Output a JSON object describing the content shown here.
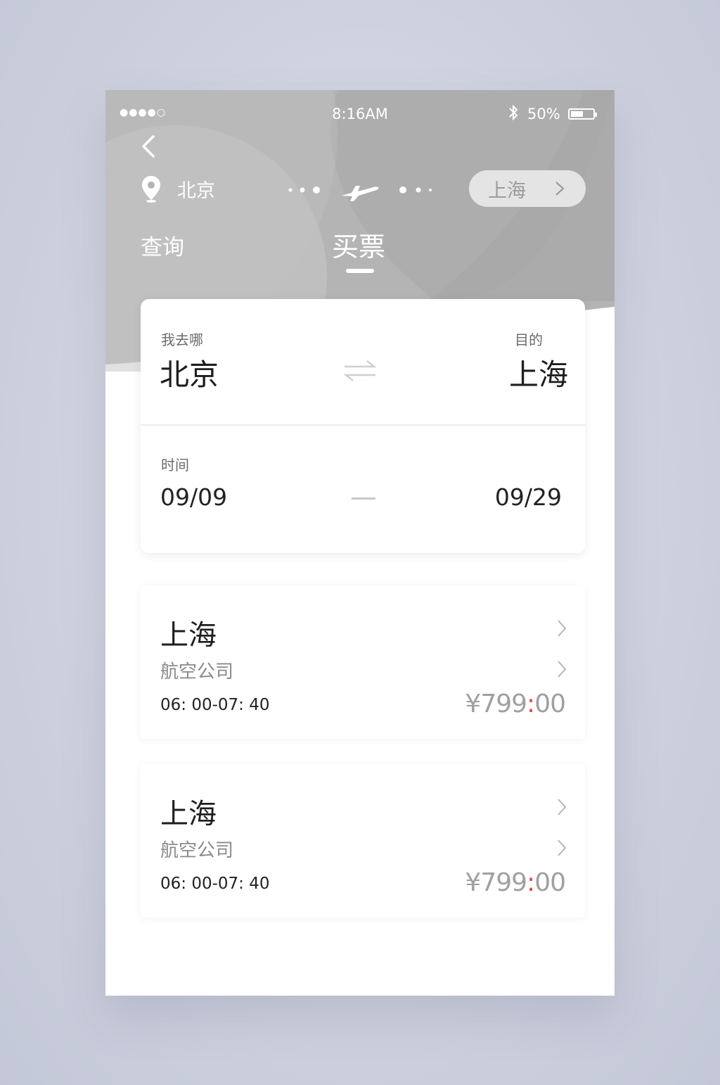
{
  "status_bar": {
    "signal": "●●●●○",
    "time": "8:16AM",
    "bluetooth": "bluetooth-icon",
    "battery_pct": "50%",
    "battery_level": 0.5
  },
  "header": {
    "back_icon": "chevron-left-icon",
    "origin_city": "北京",
    "route_icon": "airplane-icon",
    "destination_pill": "上海",
    "tabs": [
      {
        "label": "查询",
        "active": false
      },
      {
        "label": "买票",
        "active": true
      }
    ]
  },
  "search": {
    "from_label": "我去哪",
    "from_city": "北京",
    "swap_icon": "swap-arrows-icon",
    "to_label": "目的",
    "to_city": "上海",
    "time_label": "时间",
    "date_start": "09/09",
    "date_end": "09/29"
  },
  "flights": [
    {
      "city": "上海",
      "airline": "航空公司",
      "time": "06: 00-07: 40",
      "price_symbol": "¥",
      "price_main": "799",
      "price_colon": ":",
      "price_cents": "00"
    },
    {
      "city": "上海",
      "airline": "航空公司",
      "time": "06: 00-07: 40",
      "price_symbol": "¥",
      "price_main": "799",
      "price_colon": ":",
      "price_cents": "00"
    }
  ],
  "colors": {
    "hero_bg": "#b5b5b5",
    "card_bg": "#ffffff",
    "price_colon": "#e04b4b",
    "price": "#a0a0a0"
  }
}
